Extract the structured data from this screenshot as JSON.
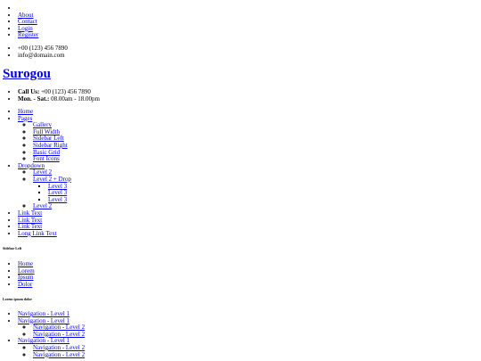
{
  "top_menu": {
    "blank": "",
    "items": [
      "About",
      "Contact",
      "Login",
      "Register"
    ]
  },
  "contact": {
    "phone": "+00 (123) 456 7890",
    "email": "info@domain.com"
  },
  "logo": {
    "text": "Surogou"
  },
  "info": {
    "call_label": "Call Us:",
    "call_value": "+00 (123) 456 7890",
    "hours_label": "Mon. - Sat.:",
    "hours_value": "08.00am - 18.00pm"
  },
  "nav": {
    "home": "Home",
    "pages": "Pages",
    "pages_items": [
      "Gallery",
      "Full Width",
      "Sidebar Left",
      "Sidebar Right",
      "Basic Grid",
      "Font Icons"
    ],
    "dropdown": "Dropdown",
    "level2_a": "Level 2",
    "level2_drop": "Level 2 + Drop",
    "level3_items": [
      "Level 3",
      "Level 3",
      "Level 3"
    ],
    "level2_b": "Level 2",
    "links": [
      "Link Text",
      "Link Text",
      "Link Text",
      "Long Link Text"
    ]
  },
  "sidebar": {
    "heading": "Sidebar Left",
    "items": [
      "Home",
      "Lorem",
      "Ipsum",
      "Dolor"
    ]
  },
  "tree": {
    "heading": "Lorem ipsum dolor",
    "l1": "Navigation - Level 1",
    "l2": "Navigation - Level 2"
  }
}
